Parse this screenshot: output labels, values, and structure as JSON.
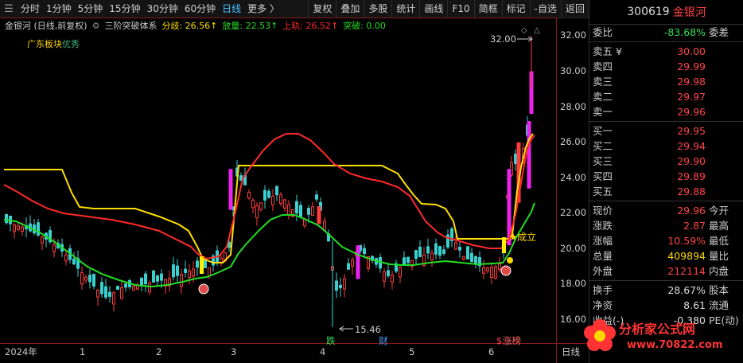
{
  "toolbar": {
    "periods": [
      "分时",
      "1分钟",
      "5分钟",
      "15分钟",
      "30分钟",
      "60分钟",
      "日线",
      "更多 〉"
    ],
    "active_period": "日线",
    "buttons": [
      "复权",
      "叠加",
      "多股",
      "统计",
      "画线",
      "F10",
      "简框",
      "标记",
      "-自选",
      "返回"
    ]
  },
  "legend": {
    "stock": "金银河 (日线,前复权)",
    "indicator": "三阶突破体系",
    "fenqi": "分歧: 26.56↑",
    "fangliang": "放量: 22.53↑",
    "shanggui": "上轨: 26.52↑",
    "tupo": "突破: 0.00"
  },
  "sector": {
    "label": "广东板块",
    "status": "优秀"
  },
  "y_axis": [
    "32.00",
    "30.00",
    "28.00",
    "26.00",
    "24.00",
    "22.00",
    "20.00",
    "18.00",
    "16.00"
  ],
  "x_axis": [
    "2024年",
    "1",
    "2",
    "3",
    "4",
    "5",
    "6",
    "日线"
  ],
  "annotations": {
    "high": "32.00",
    "low": "15.46",
    "chengli": "成立",
    "die": "跌",
    "cai": "财",
    "zhangbang": "涨榜",
    "dollar": "$"
  },
  "chart_data": {
    "type": "candlestick",
    "ylim": [
      15.5,
      32.6
    ],
    "high": 32.0,
    "low": 15.46,
    "ticks": [
      "32.00",
      "30.00",
      "28.00",
      "26.00",
      "24.00",
      "22.00",
      "20.00",
      "18.00",
      "16.00"
    ],
    "months": [
      "2024年",
      "1",
      "2",
      "3",
      "4",
      "5",
      "6"
    ]
  },
  "quote": {
    "code": "300619",
    "name": "金银河",
    "weibi_label": "委比",
    "weibi": "-83.68%",
    "weicha_label": "委差",
    "sell": [
      {
        "label": "卖五 ¥",
        "price": "30.00"
      },
      {
        "label": "卖四",
        "price": "29.99"
      },
      {
        "label": "卖三",
        "price": "29.98"
      },
      {
        "label": "卖二",
        "price": "29.97"
      },
      {
        "label": "卖一",
        "price": "29.96"
      }
    ],
    "buy": [
      {
        "label": "买一",
        "price": "29.95"
      },
      {
        "label": "买二",
        "price": "29.94"
      },
      {
        "label": "买三",
        "price": "29.90"
      },
      {
        "label": "买四",
        "price": "29.89"
      },
      {
        "label": "买五",
        "price": "29.88"
      }
    ],
    "stats": [
      {
        "label": "现价",
        "value": "29.96",
        "right": "今开",
        "color": "red"
      },
      {
        "label": "涨跌",
        "value": "2.87",
        "right": "最高",
        "color": "red"
      },
      {
        "label": "涨幅",
        "value": "10.59%",
        "right": "最低",
        "color": "red"
      },
      {
        "label": "总量",
        "value": "409894",
        "right": "量比",
        "color": "yellow"
      },
      {
        "label": "外盘",
        "value": "212114",
        "right": "内盘",
        "color": "red"
      }
    ],
    "stats2": [
      {
        "label": "换手",
        "value": "28.67%",
        "right": "股本"
      },
      {
        "label": "净资",
        "value": "8.61",
        "right": "流通"
      },
      {
        "label": "收益(-)",
        "value": "-0.380",
        "right": "PE(动)"
      }
    ]
  },
  "watermark": {
    "text": "分析家公式网",
    "url": "www.70822.com"
  }
}
